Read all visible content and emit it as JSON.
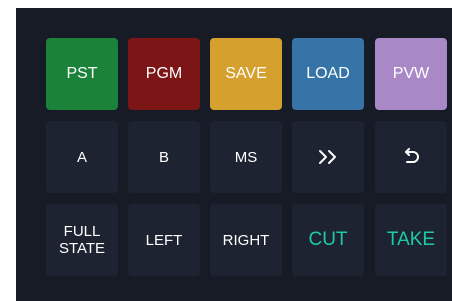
{
  "row1": {
    "pst": "PST",
    "pgm": "PGM",
    "save": "SAVE",
    "load": "LOAD",
    "pvw": "PVW"
  },
  "row2": {
    "a": "A",
    "b": "B",
    "ms": "MS",
    "forward_icon": "double-chevron-right-icon",
    "undo_icon": "undo-arrow-icon"
  },
  "row3": {
    "full_state": "FULL\nSTATE",
    "left": "LEFT",
    "right": "RIGHT",
    "cut": "CUT",
    "take": "TAKE"
  },
  "colors": {
    "panel": "#161b26",
    "button": "#1d2331",
    "pst": "#1b823a",
    "pgm": "#7c1616",
    "save": "#d6a02e",
    "load": "#3674a8",
    "pvw": "#a988c8",
    "accent_teal": "#1fc9a8"
  }
}
